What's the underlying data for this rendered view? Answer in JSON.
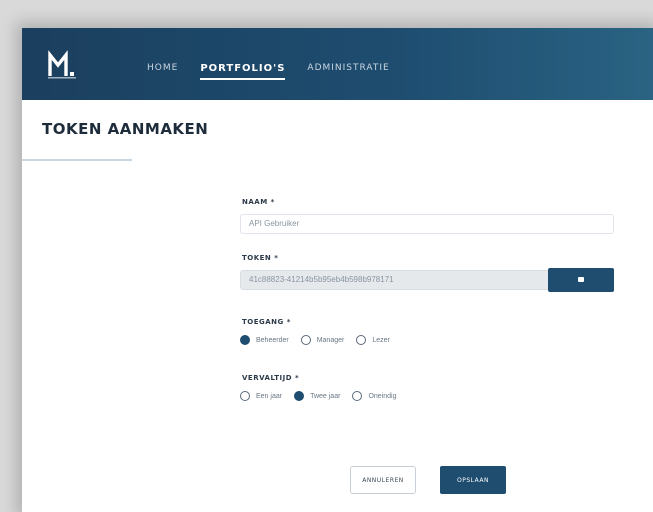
{
  "header": {
    "nav": [
      {
        "label": "HOME"
      },
      {
        "label": "PORTFOLIO'S"
      },
      {
        "label": "ADMINISTRATIE"
      }
    ]
  },
  "page": {
    "title": "TOKEN AANMAKEN"
  },
  "form": {
    "naam": {
      "label": "NAAM *",
      "value": "API Gebruiker"
    },
    "token": {
      "label": "TOKEN *",
      "value": "41c88823-41214b5b95eb4b598b978171"
    },
    "toegang": {
      "label": "TOEGANG *",
      "options": [
        {
          "label": "Beheerder",
          "selected": true
        },
        {
          "label": "Manager",
          "selected": false
        },
        {
          "label": "Lezer",
          "selected": false
        }
      ]
    },
    "vervaltijd": {
      "label": "VERVALTIJD *",
      "options": [
        {
          "label": "Een jaar",
          "selected": false
        },
        {
          "label": "Twee jaar",
          "selected": true
        },
        {
          "label": "Oneindig",
          "selected": false
        }
      ]
    }
  },
  "actions": {
    "cancel_label": "ANNULEREN",
    "save_label": "OPSLAAN"
  },
  "colors": {
    "primary": "#1f4d6f",
    "header_start": "#1b3f5e",
    "header_end": "#2a6383"
  }
}
